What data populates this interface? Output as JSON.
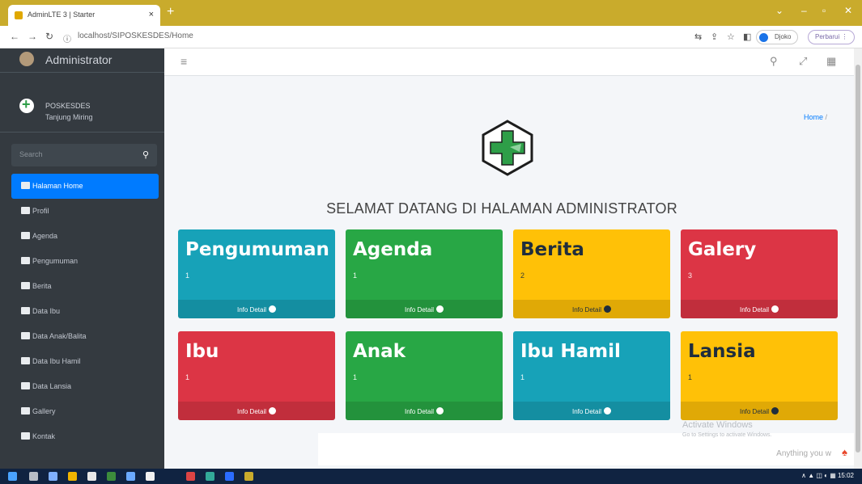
{
  "browser": {
    "tab_title": "AdminLTE 3 | Starter",
    "tab_close": "×",
    "new_tab": "+",
    "url": "localhost/SIPOSKESDES/Home",
    "profile_label": "Djoko",
    "update_label": "Perbarui"
  },
  "sidebar": {
    "user": "Administrator",
    "brand_title": "POSKESDES",
    "brand_subtitle": "Tanjung Miring",
    "search_placeholder": "Search",
    "items": [
      {
        "label": "Halaman Home"
      },
      {
        "label": "Profil"
      },
      {
        "label": "Agenda"
      },
      {
        "label": "Pengumuman"
      },
      {
        "label": "Berita"
      },
      {
        "label": "Data Ibu"
      },
      {
        "label": "Data Anak/Balita"
      },
      {
        "label": "Data Ibu Hamil"
      },
      {
        "label": "Data Lansia"
      },
      {
        "label": "Gallery"
      },
      {
        "label": "Kontak"
      }
    ]
  },
  "topnav": {
    "hamburger": "≡"
  },
  "breadcrumb": {
    "home": "Home",
    "separator": "/"
  },
  "welcome": "SELAMAT DATANG DI HALAMAN ADMINISTRATOR",
  "boxes": [
    {
      "title": "Pengumuman",
      "count": "1",
      "link": "Info Detail",
      "color": "#17a2b8"
    },
    {
      "title": "Agenda",
      "count": "1",
      "link": "Info Detail",
      "color": "#28a745"
    },
    {
      "title": "Berita",
      "count": "2",
      "link": "Info Detail",
      "color": "#ffc107"
    },
    {
      "title": "Galery",
      "count": "3",
      "link": "Info Detail",
      "color": "#dc3545"
    },
    {
      "title": "Ibu",
      "count": "1",
      "link": "Info Detail",
      "color": "#dc3545"
    },
    {
      "title": "Anak",
      "count": "1",
      "link": "Info Detail",
      "color": "#28a745"
    },
    {
      "title": "Ibu Hamil",
      "count": "1",
      "link": "Info Detail",
      "color": "#17a2b8"
    },
    {
      "title": "Lansia",
      "count": "1",
      "link": "Info Detail",
      "color": "#ffc107"
    }
  ],
  "overlay": {
    "activate_title": "Activate Windows",
    "activate_sub": "Go to Settings to activate Windows.",
    "anything": "Anything you w"
  },
  "colors": {
    "sidebar": "#343a40",
    "active": "#007bff",
    "browser_tabbar": "#c9ab2c"
  }
}
